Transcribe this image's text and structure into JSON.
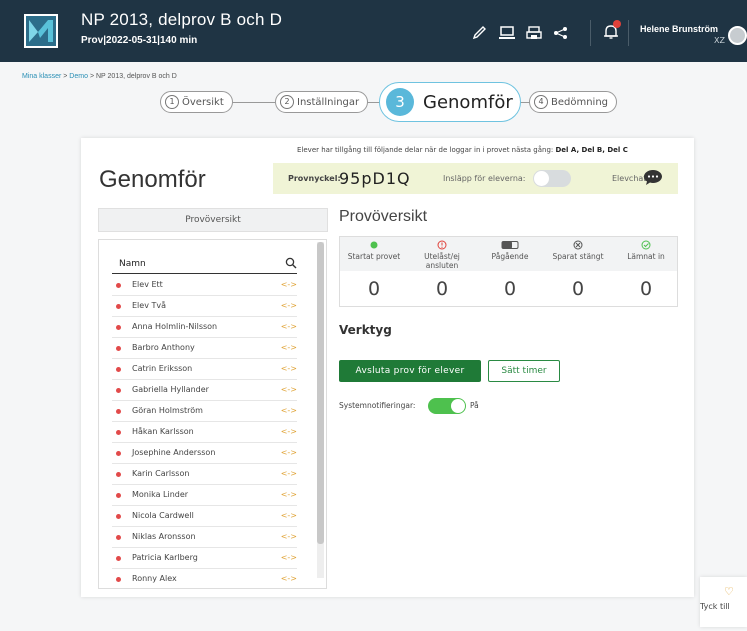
{
  "header": {
    "title": "NP 2013, delprov B och D",
    "subtitle": "Prov|2022-05-31|140 min",
    "user_name": "Helene Brunström",
    "user_initials": "XZ",
    "notification_count": 3
  },
  "breadcrumb": {
    "items": [
      "Mina klasser",
      "Demo",
      "NP 2013, delprov B och D"
    ],
    "separator": ">"
  },
  "stepper": {
    "steps": [
      {
        "num": "1",
        "label": "Översikt"
      },
      {
        "num": "2",
        "label": "Inställningar"
      },
      {
        "num": "3",
        "label": "Genomför"
      },
      {
        "num": "4",
        "label": "Bedömning"
      }
    ],
    "active_index": 2
  },
  "card": {
    "access_note_prefix": "Elever har tillgång till följande delar när de loggar in i provet nästa gång:",
    "access_note_parts": "Del A, Del B, Del C",
    "page_title": "Genomför",
    "key_label": "Provnyckel:",
    "key_value": "95pD1Q",
    "inslapp_label": "Insläpp för eleverna:",
    "inslapp_on": false,
    "chat_label": "Elevchatt:"
  },
  "overview_tab": {
    "label": "Provöversikt"
  },
  "student_list": {
    "header": "Namn",
    "students": [
      "Elev Ett",
      "Elev Två",
      "Anna Holmlin-Nilsson",
      "Barbro Anthony",
      "Catrin Eriksson",
      "Gabriella Hyllander",
      "Göran Holmström",
      "Håkan Karlsson",
      "Josephine Andersson",
      "Karin Carlsson",
      "Monika Linder",
      "Nicola Cardwell",
      "Niklas Aronsson",
      "Patricia Karlberg",
      "Ronny Alex"
    ],
    "arrow_glyph": "<->"
  },
  "overview": {
    "title": "Provöversikt",
    "stats": [
      {
        "label": "Startat provet",
        "value": "0",
        "icon": "green-dot-icon",
        "color": "#4ec14e"
      },
      {
        "label": "Utelåst/ej ansluten",
        "value": "0",
        "icon": "alert-circle-icon",
        "color": "#e0413a"
      },
      {
        "label": "Pågående",
        "value": "0",
        "icon": "progress-bar-icon",
        "color": "#555555"
      },
      {
        "label": "Sparat stängt",
        "value": "0",
        "icon": "x-circle-icon",
        "color": "#555555"
      },
      {
        "label": "Lämnat in",
        "value": "0",
        "icon": "check-circle-icon",
        "color": "#4ec14e"
      }
    ]
  },
  "tools": {
    "title": "Verktyg",
    "end_button": "Avsluta prov för elever",
    "timer_button": "Sätt timer",
    "notif_label": "Systemnotifieringar:",
    "notif_state": "På",
    "notif_on": true
  },
  "feedback": {
    "label": "Tyck till"
  },
  "colors": {
    "header_bg": "#1f3444",
    "accent_blue": "#5ab8da",
    "primary_green": "#1f7a37",
    "toggle_green": "#4ec14e",
    "status_red": "#e24a4a",
    "arrow_orange": "#e0a53a"
  }
}
